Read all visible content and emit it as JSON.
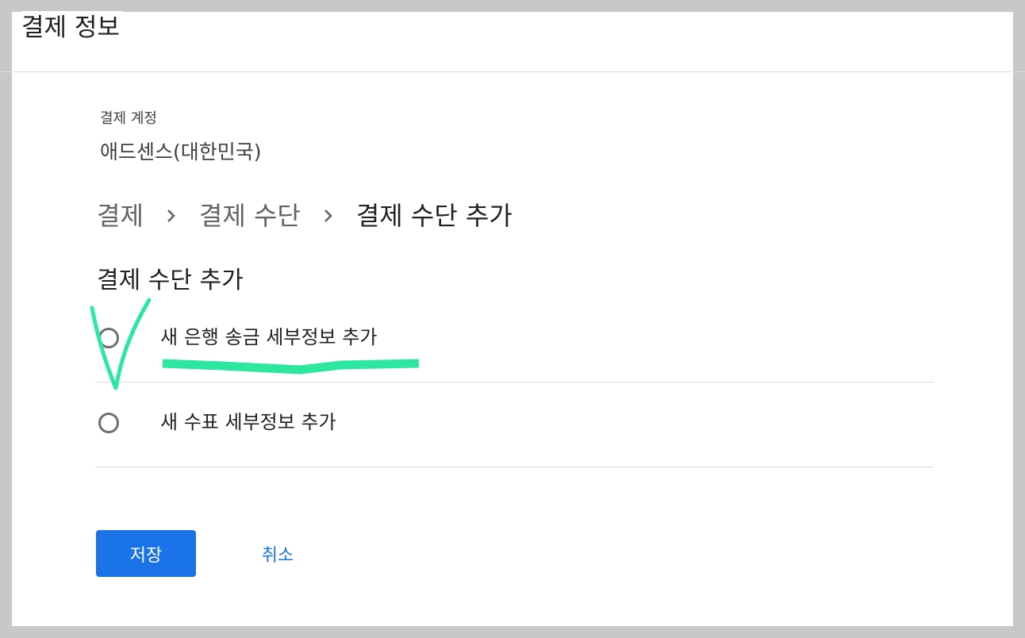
{
  "page": {
    "title": "결제 정보"
  },
  "account": {
    "label": "결제 계정",
    "value": "애드센스(대한민국)"
  },
  "breadcrumb": {
    "items": [
      "결제",
      "결제 수단",
      "결제 수단 추가"
    ]
  },
  "section": {
    "title": "결제 수단 추가"
  },
  "options": [
    {
      "label": "새 은행 송금 세부정보 추가",
      "selected": false
    },
    {
      "label": "새 수표 세부정보 추가",
      "selected": false
    }
  ],
  "actions": {
    "save_label": "저장",
    "cancel_label": "취소"
  },
  "colors": {
    "primary": "#1a73e8",
    "annotation": "#2de6a0",
    "text": "#202124",
    "secondary_text": "#5f6368"
  }
}
